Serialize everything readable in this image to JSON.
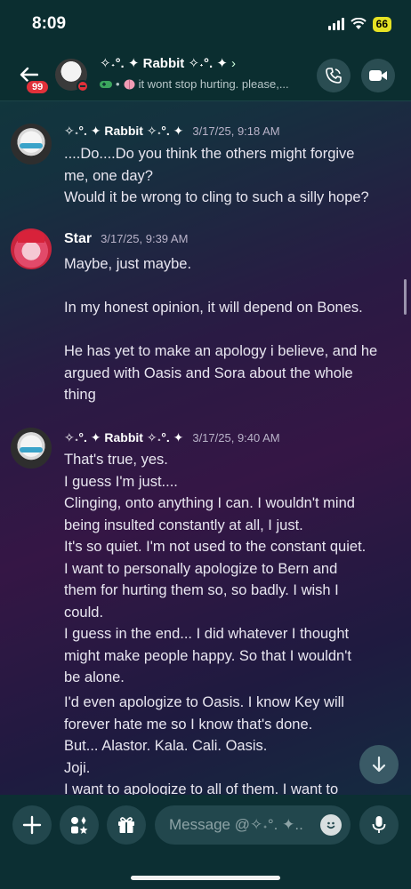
{
  "status_bar": {
    "time": "8:09",
    "battery": "66"
  },
  "header": {
    "unread_badge": "99",
    "name": "✧˖°. ✦ Rabbit ✧˖°. ✦",
    "chevron": "›",
    "status_text": "it wont stop hurting. please,..."
  },
  "messages": [
    {
      "author": "✧˖°. ✦ Rabbit ✧˖°. ✦",
      "timestamp": "3/17/25, 9:18 AM",
      "lines": [
        "....Do....Do you think the others might forgive",
        "me, one day?",
        "Would it be wrong to cling to such a silly hope?"
      ]
    },
    {
      "author": "Star",
      "timestamp": "3/17/25, 9:39 AM",
      "lines": [
        "Maybe, just maybe.",
        "",
        "In my honest opinion, it will depend on Bones.",
        "",
        "He has yet to make an apology i believe, and he",
        "argued with Oasis and Sora about the whole",
        "thing"
      ]
    },
    {
      "author": "✧˖°. ✦ Rabbit ✧˖°. ✦",
      "timestamp": "3/17/25, 9:40 AM",
      "lines": [
        "That's true, yes.",
        "I guess I'm just....",
        "Clinging, onto anything I can. I wouldn't mind",
        "being insulted constantly at all, I just.",
        "It's so quiet. I'm not used to the constant quiet.",
        "I want to personally apologize to Bern and",
        "them for hurting them so, so badly. I wish I",
        "could.",
        "I guess in the end... I did whatever I thought",
        "might make people happy. So that I wouldn't",
        "be alone."
      ],
      "lines2": [
        "I'd even apologize to Oasis. I know Key will",
        "forever hate me so I know that's done.",
        "But... Alastor. Kala. Cali. Oasis.",
        "Joji.",
        "I want to apologize to all of them. I want to"
      ]
    }
  ],
  "composer": {
    "placeholder": "Message @✧˖°. ✦..."
  }
}
